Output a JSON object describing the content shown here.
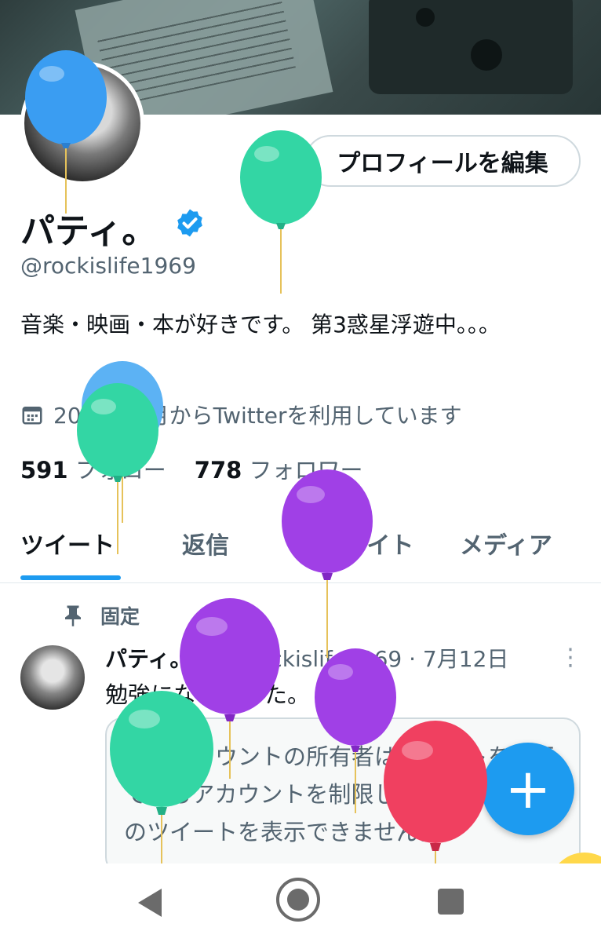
{
  "profile": {
    "edit_button": "プロフィールを編集",
    "name": "パティ。",
    "handle": "@rockislife1969",
    "bio": "音楽・映画・本が好きです。 第3惑星浮遊中。。。",
    "joined": "20　年　月からTwitterを利用しています",
    "following_count": "591",
    "following_label": "フォロー",
    "followers_count": "778",
    "followers_label": "フォロワー"
  },
  "tabs": [
    "ツイート",
    "返信",
    "ハイライト",
    "メディア"
  ],
  "tweet": {
    "pinned_label": "固定",
    "name": "パティ。",
    "handle_time": "@rockislife1969 · 7月12日",
    "text": "勉強になりました。",
    "card_text": "このアカウントの所有者はツイートを表示できるアカウントを制限しているため、このツイートを表示できません。"
  },
  "fab_label": "+",
  "icons": [
    "verified-badge-icon",
    "calendar-icon",
    "pin-icon",
    "more-vertical-icon",
    "compose-plus-icon",
    "back-icon",
    "home-icon",
    "recent-apps-icon"
  ],
  "colors": {
    "accent": "#1d9bf0",
    "secondary_text": "#536471",
    "balloon_blue": "#3a9df2",
    "balloon_green": "#33d6a4",
    "balloon_purple": "#a040e6",
    "balloon_red": "#f04060"
  }
}
